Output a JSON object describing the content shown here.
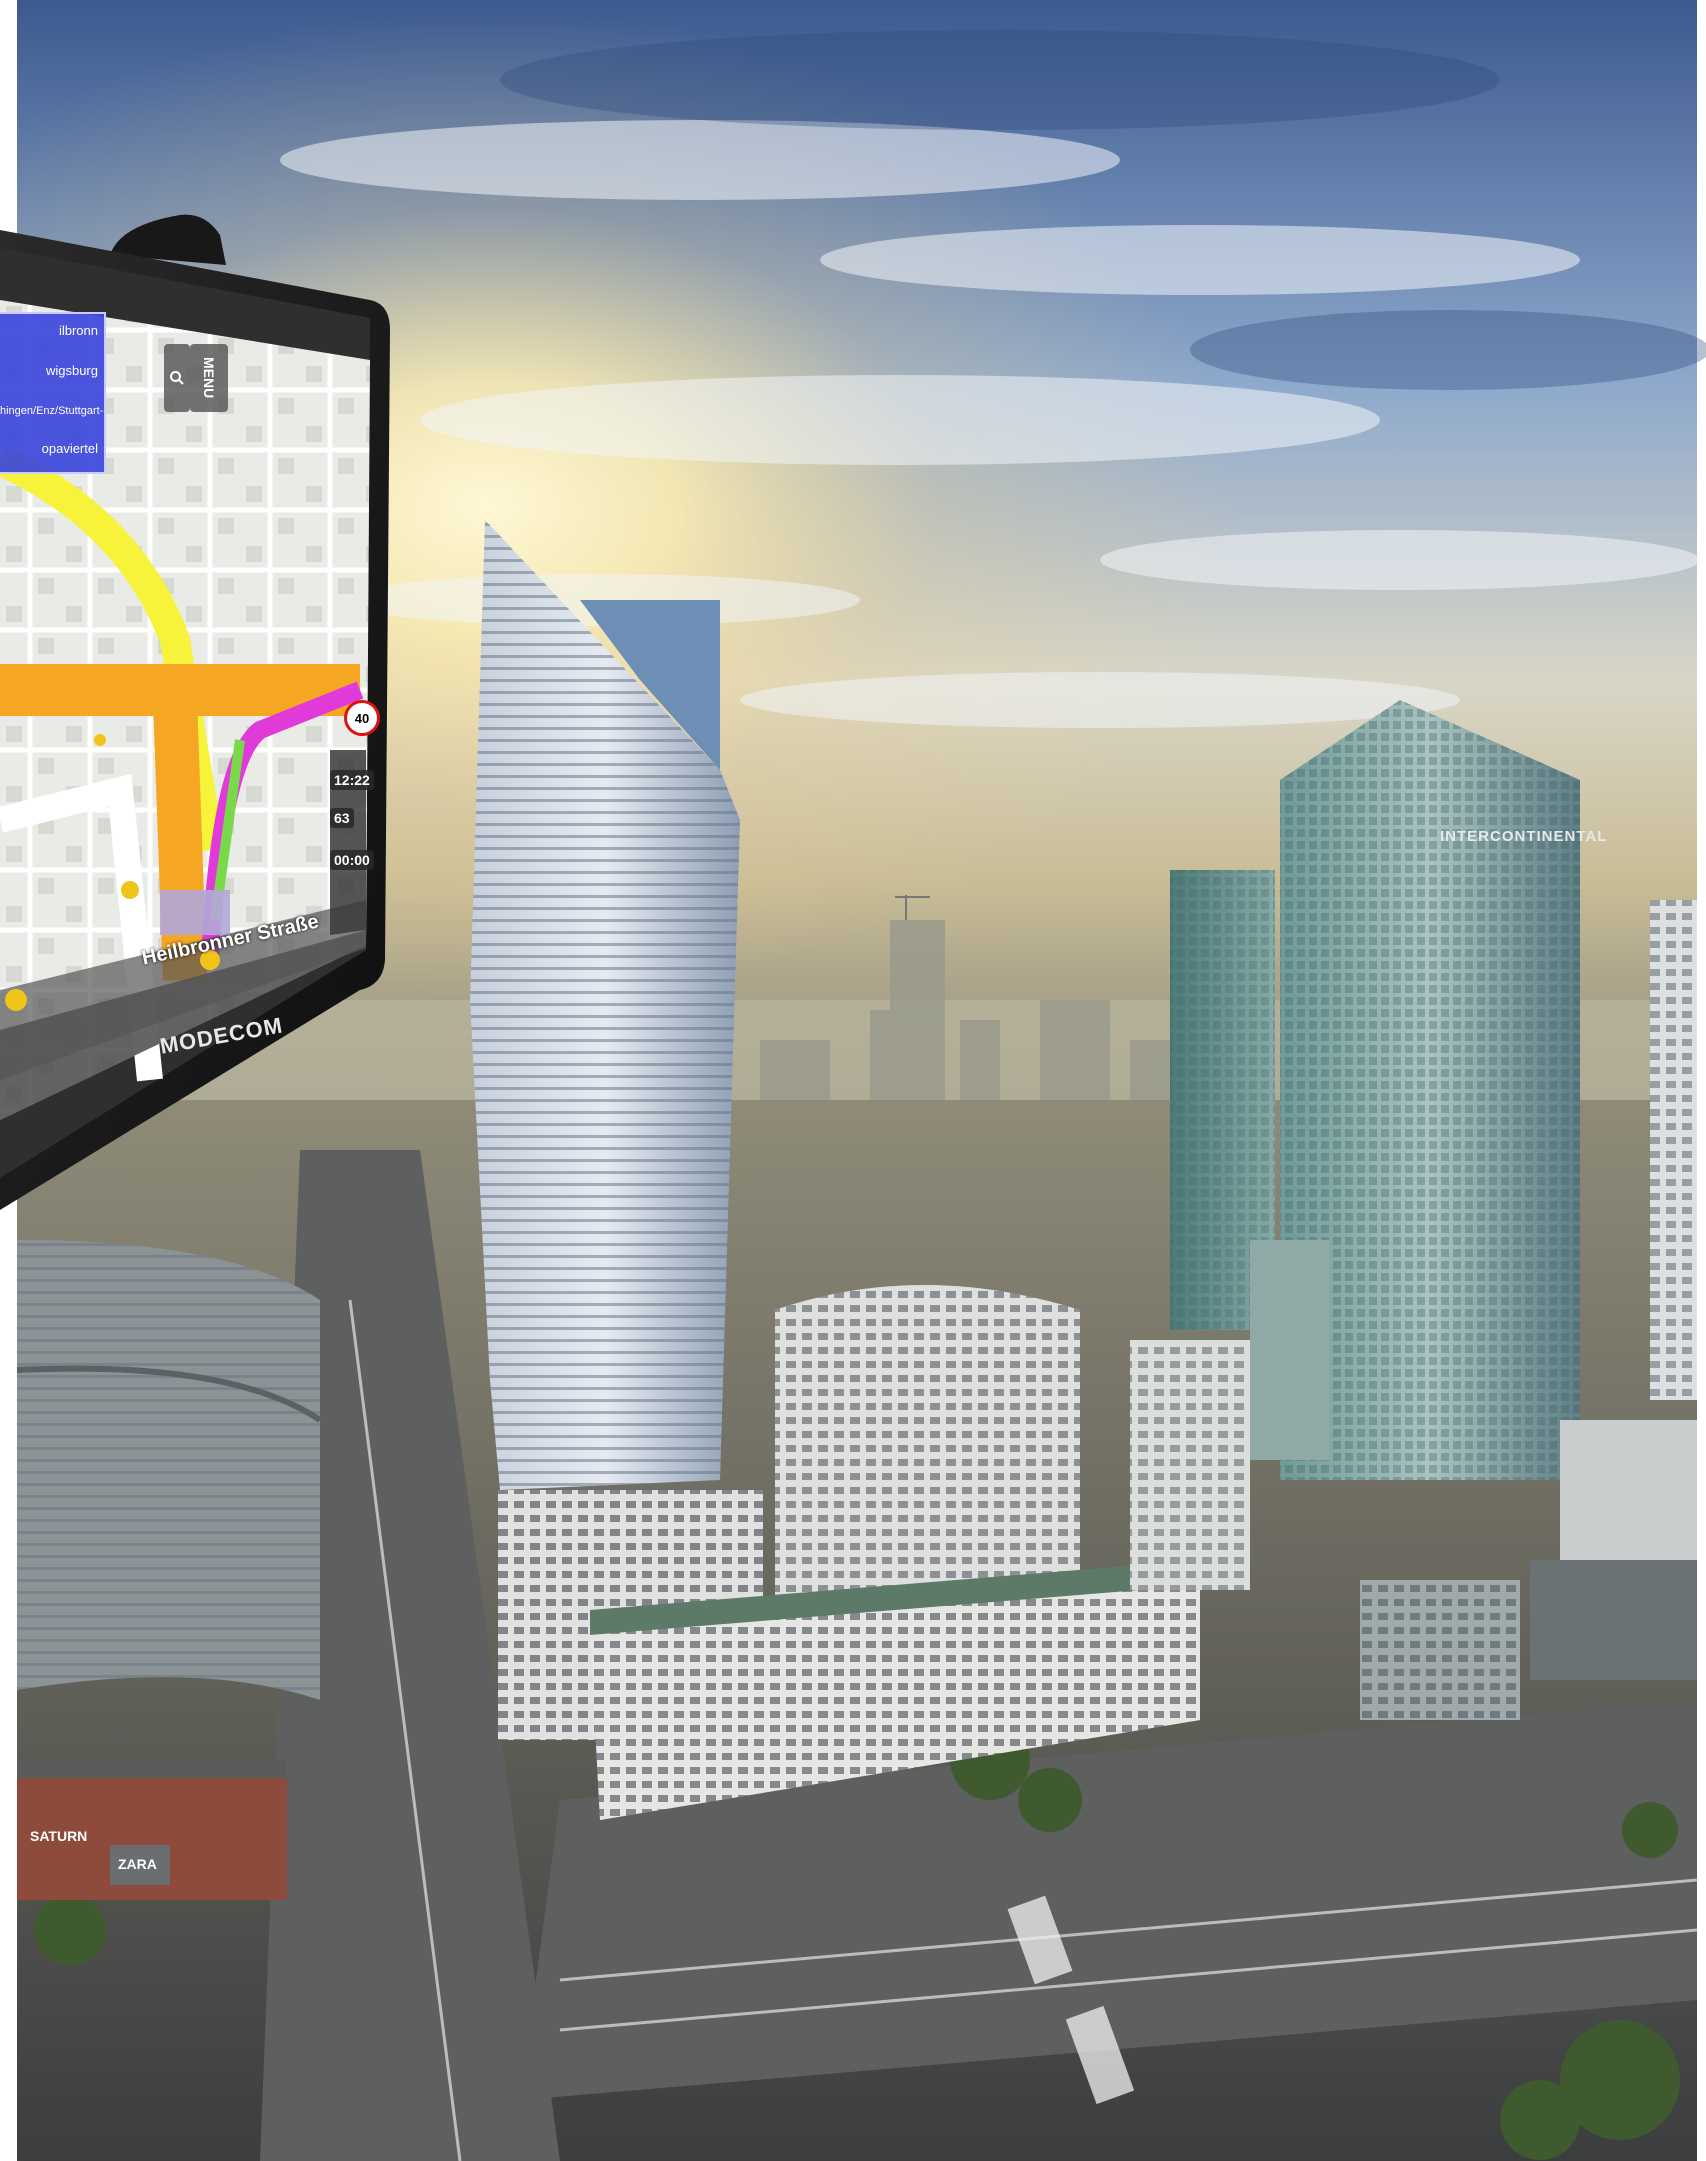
{
  "device": {
    "brand": "MODECOM",
    "destinations": [
      "ilbronn",
      "wigsburg",
      "hingen/Enz/Stuttgart-Nord",
      "opaviertel"
    ],
    "menu_label": "MENU",
    "time": "12:22",
    "distance": "63",
    "eta": "00:00",
    "speed_limit": "40",
    "street": "Heilbronner Straße"
  },
  "signs": {
    "hotel": "INTERCONTINENTAL",
    "store1": "SATURN",
    "store2": "ZARA"
  },
  "colors": {
    "sky_top": "#3f5f96",
    "sky_mid": "#9fb8d6",
    "sun_glow": "#fff3c2",
    "route_orange": "#f5a623",
    "route_pink": "#e03ad8",
    "highway_yellow": "#f7f23a",
    "device_body": "#1b1b1b"
  }
}
